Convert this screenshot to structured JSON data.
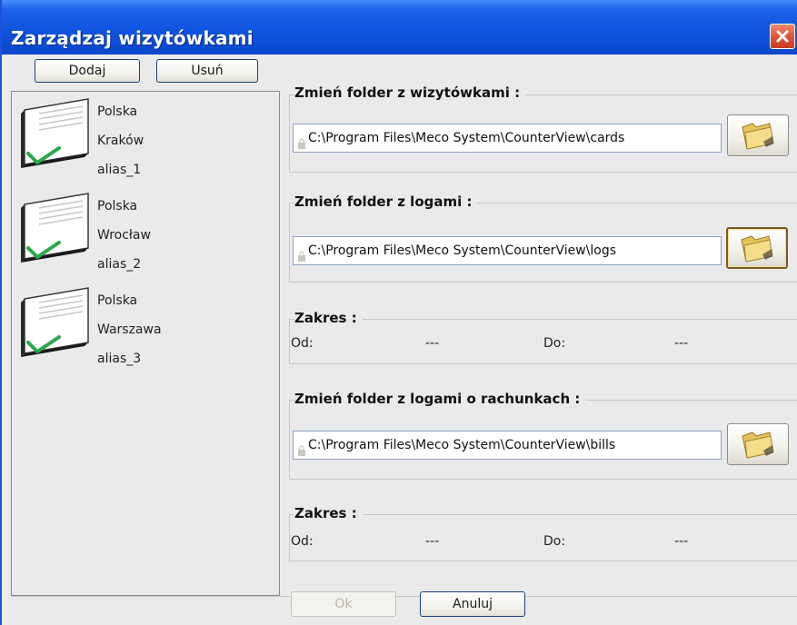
{
  "window": {
    "title": "Zarządzaj wizytówkami"
  },
  "list_toolbar": {
    "add_label": "Dodaj",
    "remove_label": "Usuń"
  },
  "cards": [
    {
      "country": "Polska",
      "city": "Kraków",
      "alias": "alias_1"
    },
    {
      "country": "Polska",
      "city": "Wrocław",
      "alias": "alias_2"
    },
    {
      "country": "Polska",
      "city": "Warszawa",
      "alias": "alias_3"
    }
  ],
  "cards_folder": {
    "label": "Zmień folder z wizytówkami :",
    "path": "C:\\Program Files\\Meco System\\CounterView\\cards"
  },
  "logs_folder": {
    "label": "Zmień folder z logami :",
    "path": "C:\\Program Files\\Meco System\\CounterView\\logs"
  },
  "range_1": {
    "label": "Zakres :",
    "from_label": "Od:",
    "from_value": "---",
    "to_label": "Do:",
    "to_value": "---"
  },
  "bills_folder": {
    "label": "Zmień folder z logami o rachunkach :",
    "path": "C:\\Program Files\\Meco System\\CounterView\\bills"
  },
  "range_2": {
    "label": "Zakres :",
    "from_label": "Od:",
    "from_value": "---",
    "to_label": "Do:",
    "to_value": "---"
  },
  "footer": {
    "ok_label": "Ok",
    "cancel_label": "Anuluj"
  },
  "colors": {
    "titlebar": "#0f54de",
    "close_button": "#e0553a",
    "window_bg": "#ebeaea",
    "check_green": "#2aa84a",
    "folder_yellow": "#f2d77a"
  },
  "icons": {
    "close": "close-icon",
    "card": "business-card-check-icon",
    "folder": "folder-icon",
    "lock": "lock-icon"
  }
}
